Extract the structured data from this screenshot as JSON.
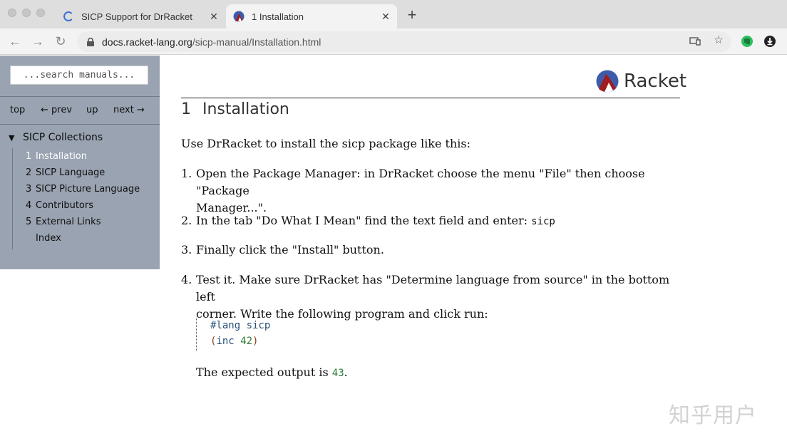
{
  "browser": {
    "tabs": [
      {
        "title": "SICP Support for DrRacket",
        "icon": "loading-spinner-icon",
        "active": false
      },
      {
        "title": "1 Installation",
        "icon": "racket-favicon",
        "active": true
      }
    ],
    "url_domain": "docs.racket-lang.org",
    "url_path": "/sicp-manual/Installation.html"
  },
  "sidebar": {
    "search_placeholder": "...search manuals...",
    "nav": {
      "top": "top",
      "prev": "← prev",
      "up": "up",
      "next": "next →"
    },
    "toc_title": "SICP Collections",
    "toc": [
      {
        "num": "1",
        "label": "Installation",
        "current": true
      },
      {
        "num": "2",
        "label": "SICP Language"
      },
      {
        "num": "3",
        "label": "SICP Picture Language"
      },
      {
        "num": "4",
        "label": "Contributors"
      },
      {
        "num": "5",
        "label": "External Links"
      },
      {
        "num": "",
        "label": "Index"
      }
    ]
  },
  "content": {
    "logo_text": "Racket",
    "section_number": "1",
    "section_title": "Installation",
    "intro": "Use DrRacket to install the sicp package like this:",
    "steps": [
      {
        "num": "1.",
        "line1": "Open the Package Manager: in DrRacket choose the menu \"File\" then choose \"Package",
        "line2": "Manager...\"."
      },
      {
        "num": "2.",
        "text": "In the tab \"Do What I Mean\" find the text field and enter: ",
        "code": "sicp"
      },
      {
        "num": "3.",
        "text": "Finally click the \"Install\" button."
      },
      {
        "num": "4.",
        "line1": "Test it. Make sure DrRacket has \"Determine language from source\" in the bottom left",
        "line2": "corner. Write the following program and click run:"
      }
    ],
    "code": {
      "lang_line": "#lang sicp",
      "open": "(",
      "fn": "inc",
      "arg": "42",
      "close": ")"
    },
    "expected_prefix": "The expected output is ",
    "expected_value": "43",
    "expected_suffix": "."
  },
  "watermark": "知乎用户"
}
